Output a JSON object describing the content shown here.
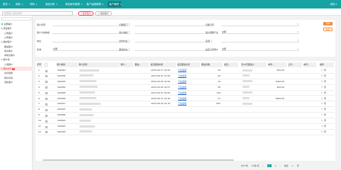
{
  "topbar": {
    "tabs": [
      {
        "label": "首页",
        "active": false
      },
      {
        "label": "销售",
        "active": false
      },
      {
        "label": "采购",
        "active": false
      },
      {
        "label": "商品分析",
        "active": false
      },
      {
        "label": "商品库存管理",
        "active": false
      },
      {
        "label": "客户运营管理",
        "active": false
      },
      {
        "label": "客户管理",
        "active": true
      }
    ],
    "right_text": "消息 ▾"
  },
  "toolbar": {
    "search_placeholder": "搜索客户名称/单号",
    "pill_red": "* 新增客户",
    "pill_plain": "○ 我的客户"
  },
  "sidebar": {
    "items": [
      {
        "label": "全部客户",
        "active": false,
        "dot": "#17a2a4"
      },
      {
        "label": "▸ 潜在客户",
        "active": false,
        "dot": ""
      },
      {
        "label": "公司客户",
        "active": false,
        "dot": ""
      },
      {
        "label": "公司客户",
        "active": false,
        "dot": ""
      },
      {
        "label": "▸ 我的客户",
        "active": false,
        "dot": ""
      },
      {
        "label": "跟进客户",
        "active": false,
        "dot": ""
      },
      {
        "label": "成交客户",
        "active": false,
        "dot": ""
      },
      {
        "label": "未成交客户",
        "active": false,
        "dot": ""
      },
      {
        "label": "▸ 客户池",
        "active": false,
        "dot": ""
      },
      {
        "label": "公海客户",
        "active": false,
        "dot": ""
      },
      {
        "label": "▾ 我的共享",
        "active": true,
        "dot": "",
        "badge": "2"
      },
      {
        "label": "共享给我",
        "active": false,
        "dot": ""
      },
      {
        "label": "我共享的",
        "active": false,
        "dot": ""
      },
      {
        "label": "流失客户",
        "active": false,
        "dot": ""
      }
    ]
  },
  "filters": [
    {
      "label": "客户名称",
      "value": ""
    },
    {
      "label": "归属部门",
      "value": ""
    },
    {
      "label": "归属人员",
      "value": ""
    },
    {
      "label": "客户分类等级",
      "value": ""
    },
    {
      "label": "客户等级",
      "value": ""
    },
    {
      "label": "客户所属行业",
      "value": "全部"
    },
    {
      "label": "地址",
      "value": ""
    },
    {
      "label": "合作状态",
      "value": ""
    },
    {
      "label": "来源",
      "value": ""
    },
    {
      "label": "区域",
      "value": "全部"
    },
    {
      "label": "跟进状态",
      "value": ""
    },
    {
      "label": "是否公海客户",
      "value": "全部"
    }
  ],
  "buttons": {
    "search": "查询",
    "reset": "重置"
  },
  "table": {
    "headers": [
      "序号",
      "",
      "客户编码",
      "客户名称",
      "客户...",
      "跟进...",
      "最近跟进时间",
      "最近跟进方式",
      "跟进次数",
      "最近...",
      "近30天跟进人",
      "本年...",
      "上月...",
      "本月...",
      "操作"
    ],
    "rows": [
      {
        "idx": "1",
        "code": "000040",
        "name_len": 28,
        "time": "2023-04-17 19:59",
        "method": "下拉选项",
        "count": "32",
        "amt": "500.00"
      },
      {
        "idx": "2",
        "code": "000036",
        "name_len": 20,
        "time": "2023-04-15 15:59",
        "method": "下拉选项",
        "count": "30",
        "amt": ""
      },
      {
        "idx": "3",
        "code": "000035",
        "name_len": 24,
        "time": "2023-03-23 10:59",
        "method": "下拉选项",
        "count": "10",
        "amt": "1000.00"
      },
      {
        "idx": "4",
        "code": "000030",
        "name_len": 26,
        "time": "2023-03-02 10:07",
        "method": "下拉选项",
        "count": "56",
        "amt": "200.00"
      },
      {
        "idx": "5",
        "code": "000028",
        "name_len": 22,
        "time": "2023-02-27 10:09",
        "method": "下拉选项",
        "count": "144",
        "amt": ""
      },
      {
        "idx": "6",
        "code": "000026",
        "name_len": 24,
        "time": "2023-02-27 10:40",
        "method": "下拉选项",
        "count": "47",
        "amt": "3000.00"
      },
      {
        "idx": "7",
        "code": "000011",
        "name_len": 30,
        "time": "2023-05-19 13:15",
        "method": "下拉选项",
        "count": "561",
        "amt": ""
      },
      {
        "idx": "8",
        "code": "000007",
        "name_len": 18,
        "time": "",
        "method": "",
        "count": "",
        "amt": ""
      },
      {
        "idx": "9",
        "code": "000006",
        "name_len": 20,
        "time": "",
        "method": "",
        "count": "",
        "amt": ""
      },
      {
        "idx": "10",
        "code": "000024",
        "name_len": 16,
        "time": "",
        "method": "",
        "count": "",
        "amt": ""
      },
      {
        "idx": "11",
        "code": "000023",
        "name_len": 22,
        "time": "",
        "method": "",
        "count": "",
        "amt": ""
      },
      {
        "idx": "12",
        "code": "000018",
        "name_len": 18,
        "time": "",
        "method": "",
        "count": "",
        "amt": ""
      }
    ]
  },
  "pager": {
    "total": "共37条",
    "size": "20条/页",
    "prev": "‹",
    "page": "1",
    "p2": "2",
    "next": "›",
    "goto": "前往",
    "goto_page": "1",
    "unit": "页"
  }
}
